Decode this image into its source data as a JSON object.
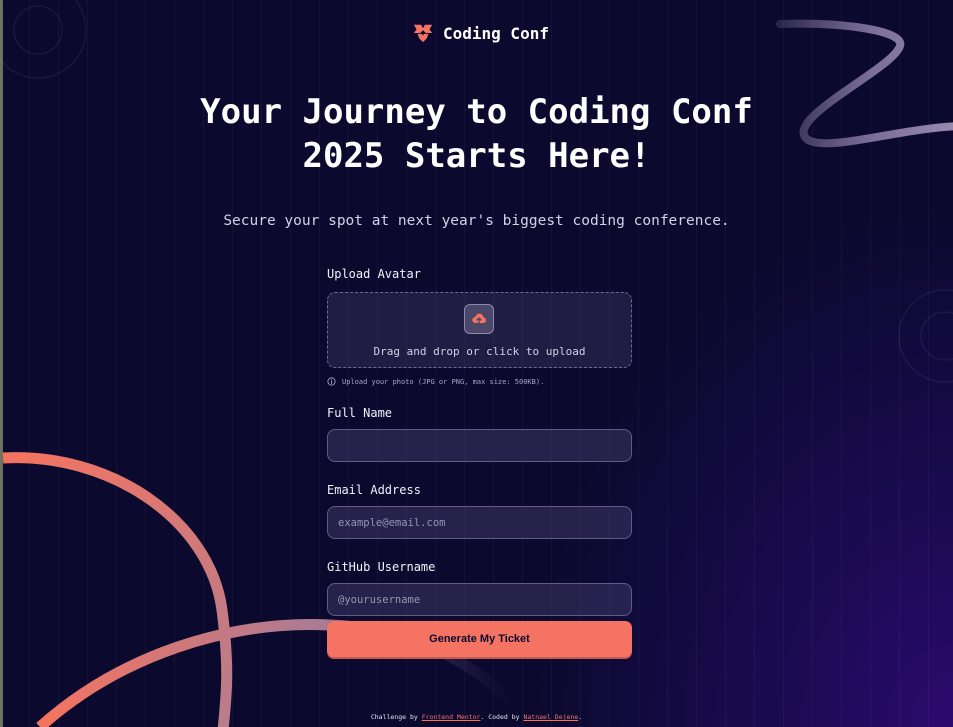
{
  "brand": {
    "name": "Coding Conf",
    "icon": "conference-logo-icon"
  },
  "hero": {
    "title_line1": "Your Journey to Coding Conf",
    "title_line2": "2025 Starts Here!",
    "subtitle": "Secure your spot at next year's biggest coding conference."
  },
  "form": {
    "avatar_label": "Upload Avatar",
    "dropzone_text": "Drag and drop or click to upload",
    "upload_icon": "cloud-upload-icon",
    "hint": "Upload your photo (JPG or PNG, max size: 500KB).",
    "full_name_label": "Full Name",
    "full_name_value": "",
    "email_label": "Email Address",
    "email_placeholder": "example@email.com",
    "github_label": "GitHub Username",
    "github_placeholder": "@yourusername",
    "submit_label": "Generate My Ticket"
  },
  "footer": {
    "prefix": "Challenge by",
    "link1": "Frontend Mentor",
    "middle": ". Coded by",
    "link2": "Natnael Dejene",
    "suffix": "."
  },
  "colors": {
    "accent": "#f57362",
    "background": "#0b0a2e",
    "field": "#4a4768"
  }
}
